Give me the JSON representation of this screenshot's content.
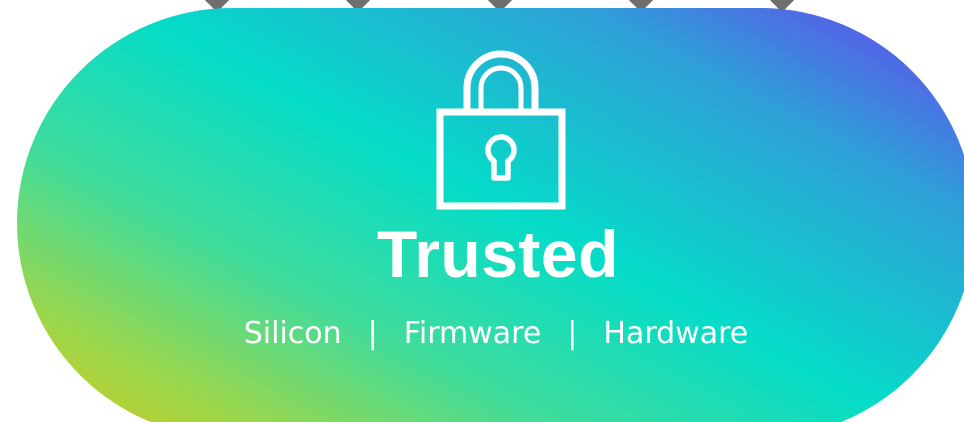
{
  "badge": {
    "title": "Trusted",
    "items": [
      "Silicon",
      "Firmware",
      "Hardware"
    ],
    "separator": "|"
  },
  "icons": {
    "main": "lock-icon"
  },
  "colors": {
    "text": "#ffffff",
    "connector": "#6e6e6e",
    "gradient": [
      "#6a3df0",
      "#2f9fd8",
      "#05dcc8",
      "#3fdc9d",
      "#9ed649",
      "#d6c719"
    ]
  }
}
